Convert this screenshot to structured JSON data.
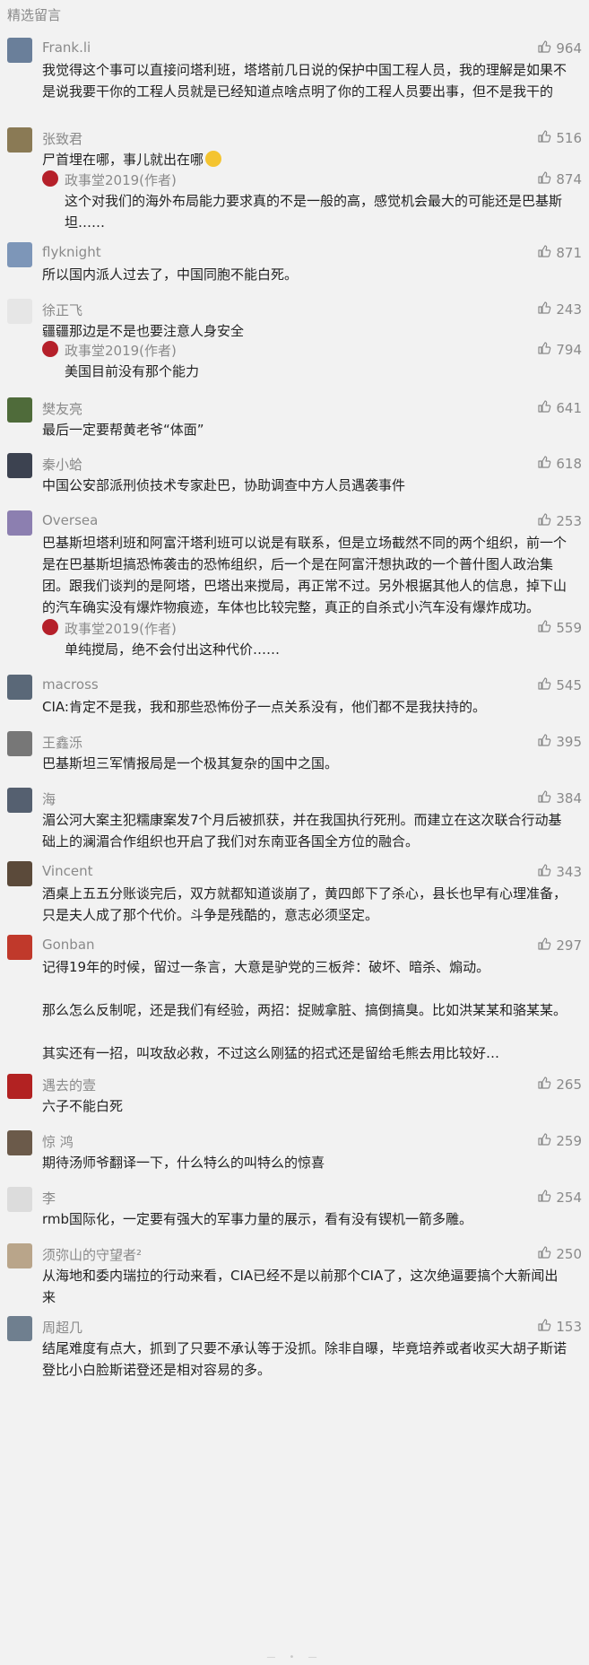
{
  "section_title": "精选留言",
  "colors": {
    "like_gray": "#8a8a8a",
    "text": "#222222",
    "bg": "#f2f2f2"
  },
  "comments": [
    {
      "nick": "Frank.li",
      "likes": "964",
      "text": "我觉得这个事可以直接问塔利班，塔塔前几日说的保护中国工程人员，我的理解是如果不是说我要干你的工程人员就是已经知道点啥点明了你的工程人员要出事，但不是我干的",
      "avatar_color": "#6a7f9a"
    },
    {
      "nick": "张致君",
      "likes": "516",
      "text": "尸首埋在哪，事儿就出在哪",
      "avatar_color": "#8a7a55",
      "reply": {
        "nick": "政事堂2019(作者)",
        "likes": "874",
        "text": "这个对我们的海外布局能力要求真的不是一般的高，感觉机会最大的可能还是巴基斯坦……"
      }
    },
    {
      "nick": "flyknight",
      "likes": "871",
      "text": "所以国内派人过去了，中国同胞不能白死。",
      "avatar_color": "#7d96b8"
    },
    {
      "nick": "徐正飞",
      "likes": "243",
      "text": "疆疆那边是不是也要注意人身安全",
      "avatar_color": "#e6e6e6",
      "reply": {
        "nick": "政事堂2019(作者)",
        "likes": "794",
        "text": "美国目前没有那个能力"
      }
    },
    {
      "nick": "樊友亮",
      "likes": "641",
      "text": "最后一定要帮黄老爷“体面”",
      "avatar_color": "#4f6b3a"
    },
    {
      "nick": "秦小蛤",
      "likes": "618",
      "text": "中国公安部派刑侦技术专家赴巴，协助调查中方人员遇袭事件",
      "avatar_color": "#3c4250"
    },
    {
      "nick": "Oversea",
      "likes": "253",
      "text": "巴基斯坦塔利班和阿富汗塔利班可以说是有联系，但是立场截然不同的两个组织，前一个是在巴基斯坦搞恐怖袭击的恐怖组织，后一个是在阿富汗想执政的一个普什图人政治集团。跟我们谈判的是阿塔，巴塔出来搅局，再正常不过。另外根据其他人的信息，掉下山的汽车确实没有爆炸物痕迹，车体也比较完整，真正的自杀式小汽车没有爆炸成功。",
      "avatar_color": "#8c7fb0",
      "reply": {
        "nick": "政事堂2019(作者)",
        "likes": "559",
        "text": "单纯搅局，绝不会付出这种代价……"
      }
    },
    {
      "nick": "macross",
      "likes": "545",
      "text": "CIA:肯定不是我，我和那些恐怖份子一点关系没有，他们都不是我扶持的。",
      "avatar_color": "#5a6878"
    },
    {
      "nick": "王鑫泺",
      "likes": "395",
      "text": "巴基斯坦三军情报局是一个极其复杂的国中之国。",
      "avatar_color": "#777777"
    },
    {
      "nick": "海",
      "likes": "384",
      "text": "湄公河大案主犯糯康案发7个月后被抓获，并在我国执行死刑。而建立在这次联合行动基础上的澜湄合作组织也开启了我们对东南亚各国全方位的融合。",
      "avatar_color": "#556070"
    },
    {
      "nick": "Vincent",
      "likes": "343",
      "text": "酒桌上五五分账谈完后，双方就都知道谈崩了，黄四郎下了杀心，县长也早有心理准备，只是夫人成了那个代价。斗争是残酷的，意志必须坚定。",
      "avatar_color": "#5b4a3a"
    },
    {
      "nick": "Gonban",
      "likes": "297",
      "text": "记得19年的时候，留过一条言，大意是驴党的三板斧：破坏、暗杀、煽动。\n\n那么怎么反制呢，还是我们有经验，两招：捉贼拿脏、搞倒搞臭。比如洪某某和骆某某。\n\n其实还有一招，叫攻敌必救，不过这么刚猛的招式还是留给毛熊去用比较好…",
      "avatar_color": "#c0392b"
    },
    {
      "nick": "遇去的壹",
      "likes": "265",
      "text": "六子不能白死",
      "avatar_color": "#b22222"
    },
    {
      "nick": "惊 鸿",
      "likes": "259",
      "text": "期待汤师爷翻译一下，什么特么的叫特么的惊喜",
      "avatar_color": "#6b5a4a"
    },
    {
      "nick": "李",
      "likes": "254",
      "text": "rmb国际化，一定要有强大的军事力量的展示，看有没有锲机一箭多雕。",
      "avatar_color": "#dcdcdc"
    },
    {
      "nick": "须弥山的守望者²",
      "likes": "250",
      "text": "从海地和委内瑞拉的行动来看，CIA已经不是以前那个CIA了，这次绝逼要搞个大新闻出来",
      "avatar_color": "#b9a58a"
    },
    {
      "nick": "周超几",
      "likes": "153",
      "text": "结尾难度有点大，抓到了只要不承认等于没抓。除非自曝，毕竟培养或者收买大胡子斯诺登比小白脸斯诺登还是相对容易的多。",
      "avatar_color": "#6f7f8f"
    }
  ],
  "footer_dots": "— • —"
}
